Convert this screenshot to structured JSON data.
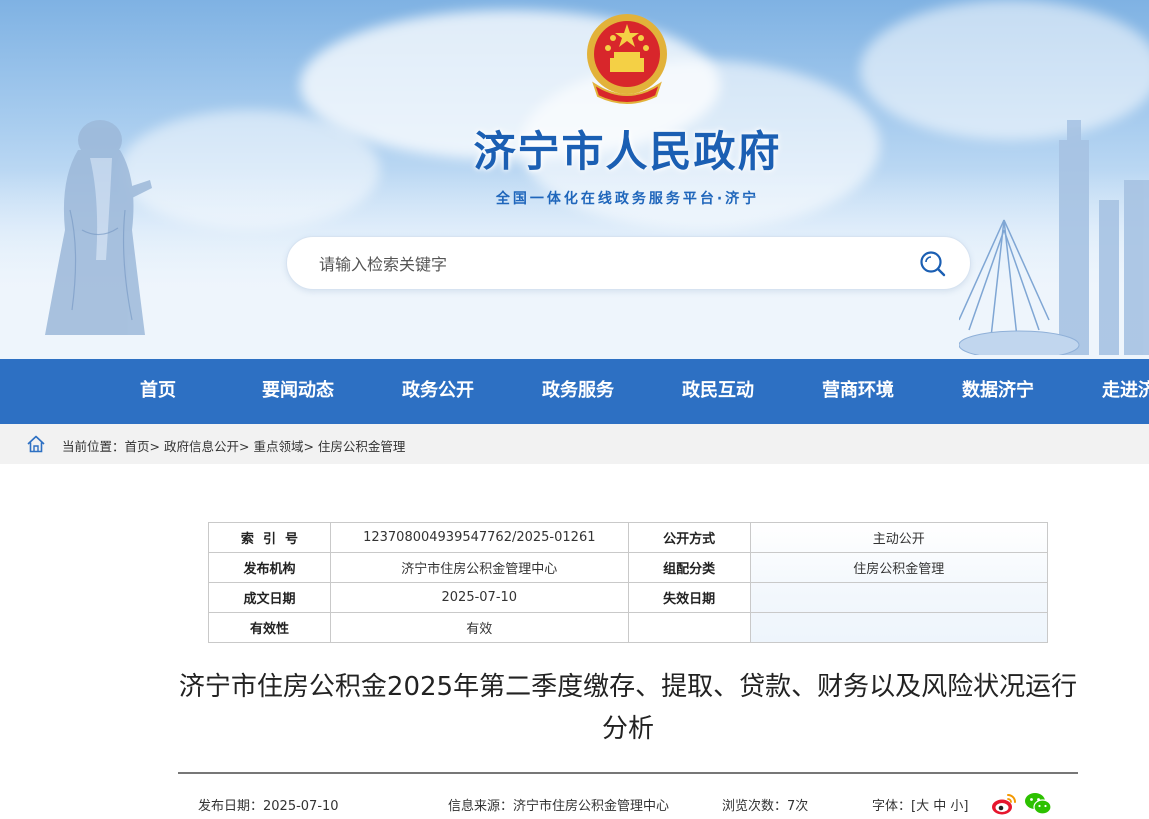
{
  "header": {
    "site_title": "济宁市人民政府",
    "site_subtitle": "全国一体化在线政务服务平台·济宁",
    "search_placeholder": "请输入检索关键字",
    "brand_color": "#2d70c3"
  },
  "nav": {
    "items": [
      "首页",
      "要闻动态",
      "政务公开",
      "政务服务",
      "政民互动",
      "营商环境",
      "数据济宁",
      "走进济宁"
    ]
  },
  "breadcrumb": {
    "prefix": "当前位置：",
    "items": [
      "首页",
      "政府信息公开",
      "重点领域",
      "住房公积金管理"
    ],
    "separator": "> "
  },
  "meta": {
    "rows": [
      [
        "索  引  号",
        "123708004939547762/2025-01261",
        "公开方式",
        "主动公开"
      ],
      [
        "发布机构",
        "济宁市住房公积金管理中心",
        "组配分类",
        "住房公积金管理"
      ],
      [
        "成文日期",
        "2025-07-10",
        "失效日期",
        ""
      ],
      [
        "有效性",
        "有效",
        "",
        ""
      ]
    ]
  },
  "article": {
    "title": "济宁市住房公积金2025年第二季度缴存、提取、贷款、财务以及风险状况运行分析",
    "publish_label": "发布日期：",
    "publish_date": "2025-07-10",
    "source_label": "信息来源：",
    "source": "济宁市住房公积金管理中心",
    "views_label": "浏览次数：",
    "views": "7次",
    "font_label": "字体：",
    "font_open": "[",
    "font_large": "大",
    "font_medium": "中",
    "font_small": "小",
    "font_close": "]",
    "share_icons": [
      "weibo-icon",
      "wechat-icon"
    ]
  }
}
